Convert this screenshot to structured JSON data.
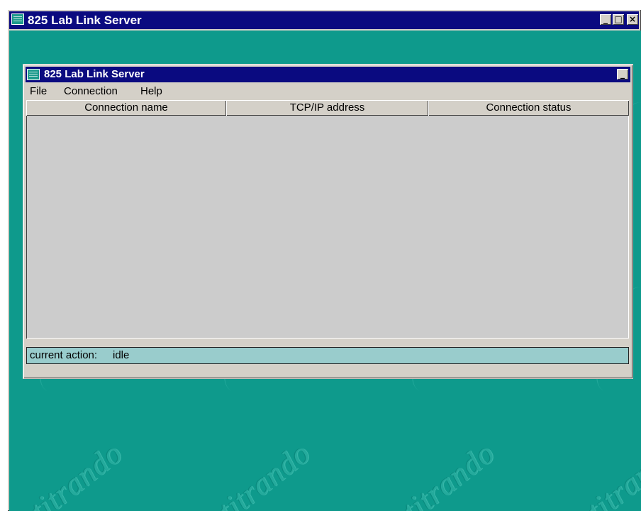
{
  "outer_window": {
    "title": "825 Lab Link Server",
    "controls": {
      "minimize": "_",
      "maximize": "□",
      "close": "×"
    }
  },
  "inner_window": {
    "title": "825 Lab Link Server",
    "controls": {
      "minimize": "_"
    }
  },
  "menu": {
    "items": [
      {
        "label": "File"
      },
      {
        "label": "Connection"
      },
      {
        "label": "Help"
      }
    ]
  },
  "table": {
    "columns": [
      "Connection name",
      "TCP/IP address",
      "Connection status"
    ],
    "rows": []
  },
  "status_bar": {
    "label": "current action:",
    "value": "idle"
  },
  "desktop": {
    "watermark_text": "titrando",
    "background_color": "#0e9a8c"
  },
  "colors": {
    "titlebar": "#0a0a80",
    "status_bar": "#99cccc"
  },
  "icons": {
    "app": "app-icon",
    "minimize": "minimize-icon",
    "maximize": "maximize-icon",
    "close": "close-icon"
  }
}
